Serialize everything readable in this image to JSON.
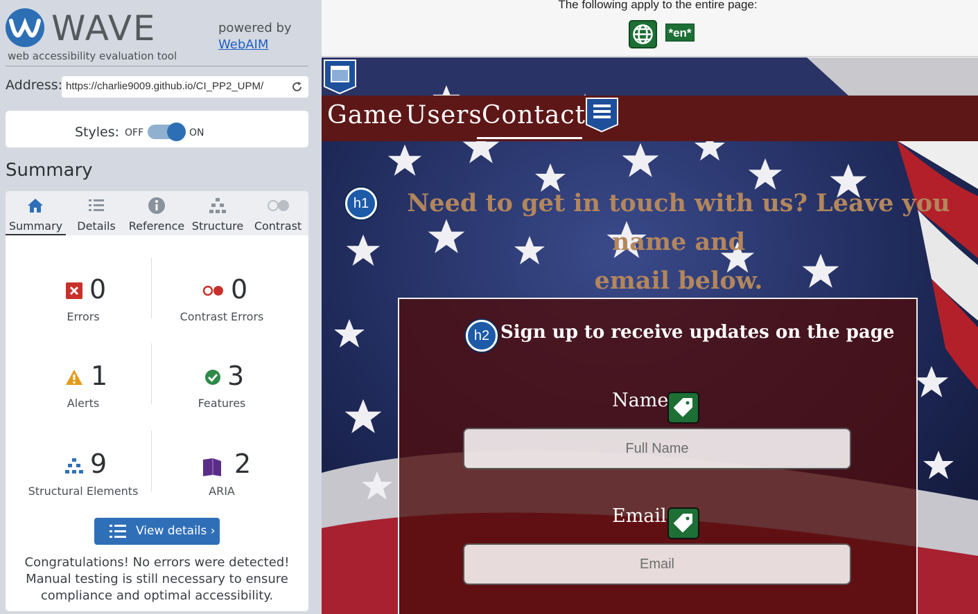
{
  "wave": {
    "logo_text": "WAVE",
    "logo_subtitle": "web accessibility evaluation tool",
    "powered_by": "powered by",
    "webaim_link": "WebAIM",
    "address_label": "Address:",
    "address_value": "https://charlie9009.github.io/CI_PP2_UPM/",
    "styles_label": "Styles:",
    "styles_off": "OFF",
    "styles_on": "ON",
    "summary_heading": "Summary",
    "tabs": [
      {
        "label": "Summary",
        "icon": "home-icon",
        "active": true
      },
      {
        "label": "Details",
        "icon": "list-icon",
        "active": false
      },
      {
        "label": "Reference",
        "icon": "info-icon",
        "active": false
      },
      {
        "label": "Structure",
        "icon": "structure-icon",
        "active": false
      },
      {
        "label": "Contrast",
        "icon": "contrast-icon",
        "active": false
      }
    ],
    "stats": {
      "errors": {
        "count": "0",
        "label": "Errors",
        "color": "#c8312b"
      },
      "contrast_errors": {
        "count": "0",
        "label": "Contrast Errors",
        "color": "#c8312b"
      },
      "alerts": {
        "count": "1",
        "label": "Alerts",
        "color": "#e39b18"
      },
      "features": {
        "count": "3",
        "label": "Features",
        "color": "#2e8a49"
      },
      "structural": {
        "count": "9",
        "label": "Structural Elements",
        "color": "#2f6fb8"
      },
      "aria": {
        "count": "2",
        "label": "ARIA",
        "color": "#5a2d86"
      }
    },
    "view_details_label": "View details ›",
    "congrats": "Congratulations! No errors were detected! Manual testing is still necessary to ensure compliance and optimal accessibility."
  },
  "page": {
    "top_note": "The following apply to the entire page:",
    "lang_badge": "*en*",
    "nav": [
      "Game",
      "Users",
      "Contact"
    ],
    "h1_badge": "h1",
    "h1_line1": "Need to get in touch with us? Leave you name and",
    "h1_line2": "email below.",
    "h2_badge": "h2",
    "h2_text": "Sign up to receive updates on the page",
    "name_label": "Name",
    "name_placeholder": "Full Name",
    "email_label": "Email",
    "email_placeholder": "Email"
  }
}
